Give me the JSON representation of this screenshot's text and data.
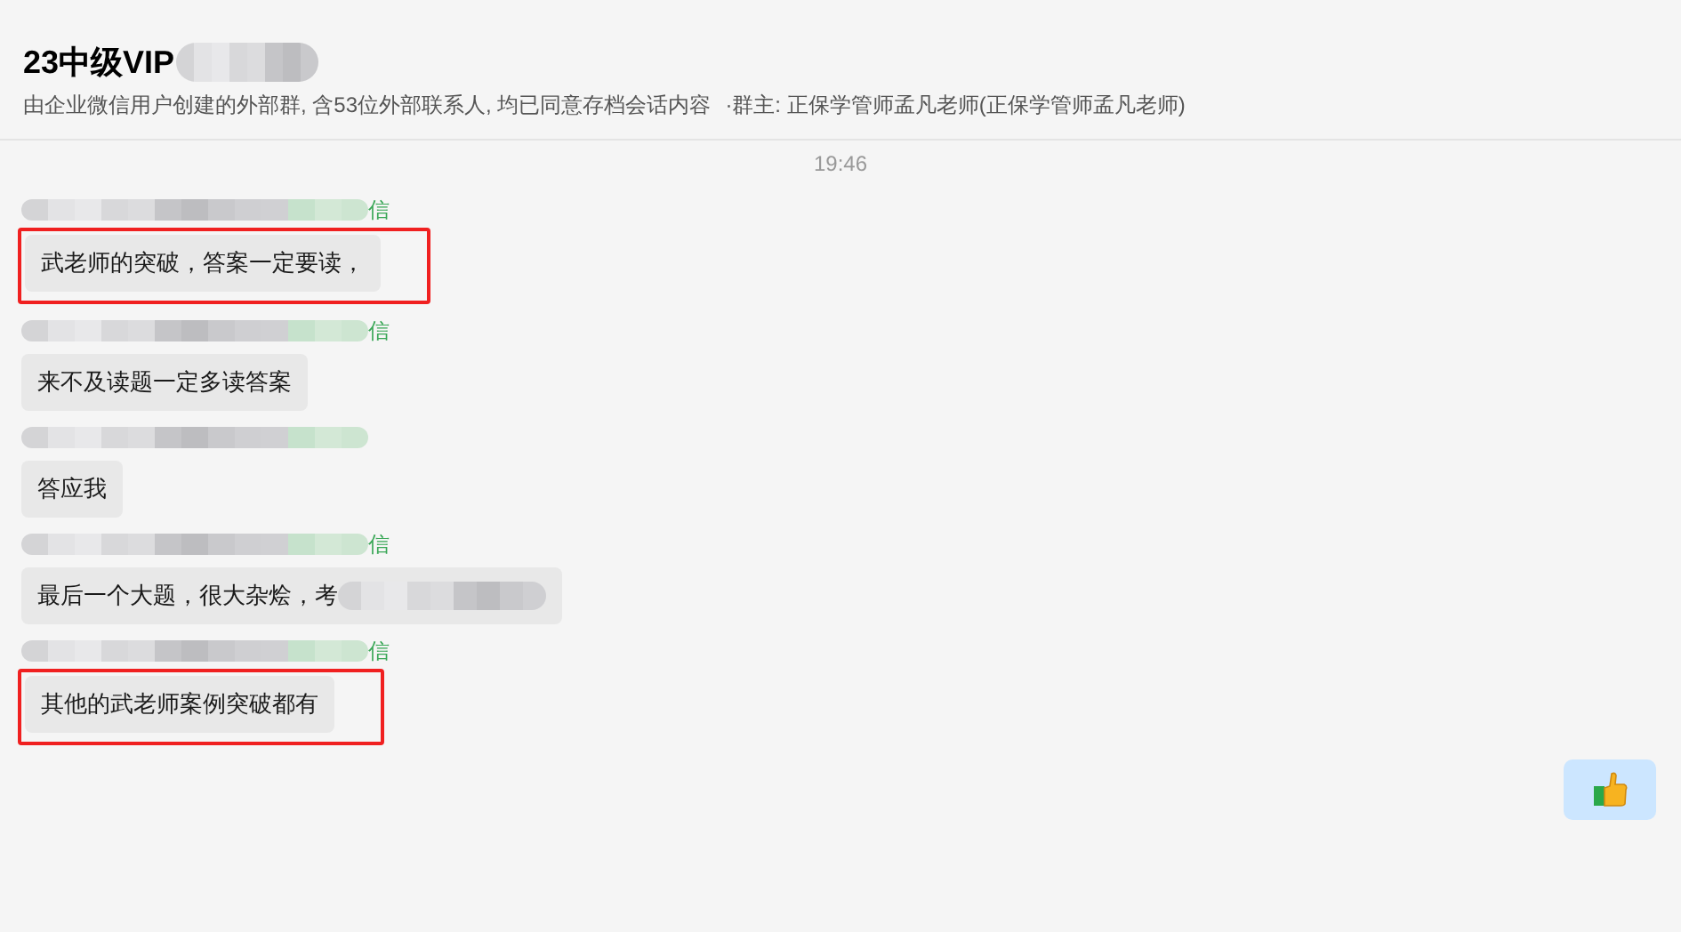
{
  "header": {
    "title": "23中级VIP",
    "subtitle": "由企业微信用户创建的外部群, 含53位外部联系人, 均已同意存档会话内容",
    "owner": "·群主: 正保学管师孟凡老师(正保学管师孟凡老师)"
  },
  "time": "19:46",
  "messages": [
    {
      "kind": "received",
      "sender_suffix": "信",
      "text": "武老师的突破，答案一定要读，",
      "highlighted": true
    },
    {
      "kind": "received",
      "sender_suffix": "信",
      "text": "来不及读题一定多读答案",
      "highlighted": false
    },
    {
      "kind": "received",
      "text": "答应我",
      "highlighted": false
    },
    {
      "kind": "received_cut",
      "sender_suffix": "信",
      "text": "最后一个大题，很大杂烩，考",
      "highlighted": false
    },
    {
      "kind": "received",
      "sender_suffix": "信",
      "text": "其他的武老师案例突破都有",
      "highlighted": true
    },
    {
      "kind": "sticker_sent"
    }
  ]
}
